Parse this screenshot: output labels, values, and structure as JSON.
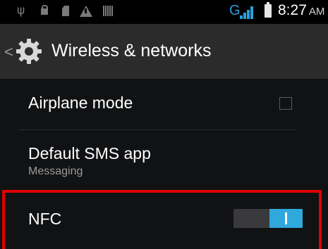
{
  "status_bar": {
    "icons": [
      "usb-icon",
      "lock-icon",
      "sd-card-icon",
      "warning-icon",
      "barcode-icon",
      "signal-icon",
      "battery-icon"
    ],
    "network_type": "G",
    "time": "8:27",
    "ampm": "AM",
    "accent_color": "#2b9fd9"
  },
  "action_bar": {
    "title": "Wireless & networks",
    "back_glyph": "<",
    "icon": "gear-icon"
  },
  "settings": {
    "airplane_mode": {
      "title": "Airplane mode",
      "checked": false
    },
    "default_sms": {
      "title": "Default SMS app",
      "summary": "Messaging"
    },
    "nfc": {
      "title": "NFC",
      "enabled": true,
      "toggle_glyph": "I",
      "highlight_color": "#e00000"
    }
  }
}
